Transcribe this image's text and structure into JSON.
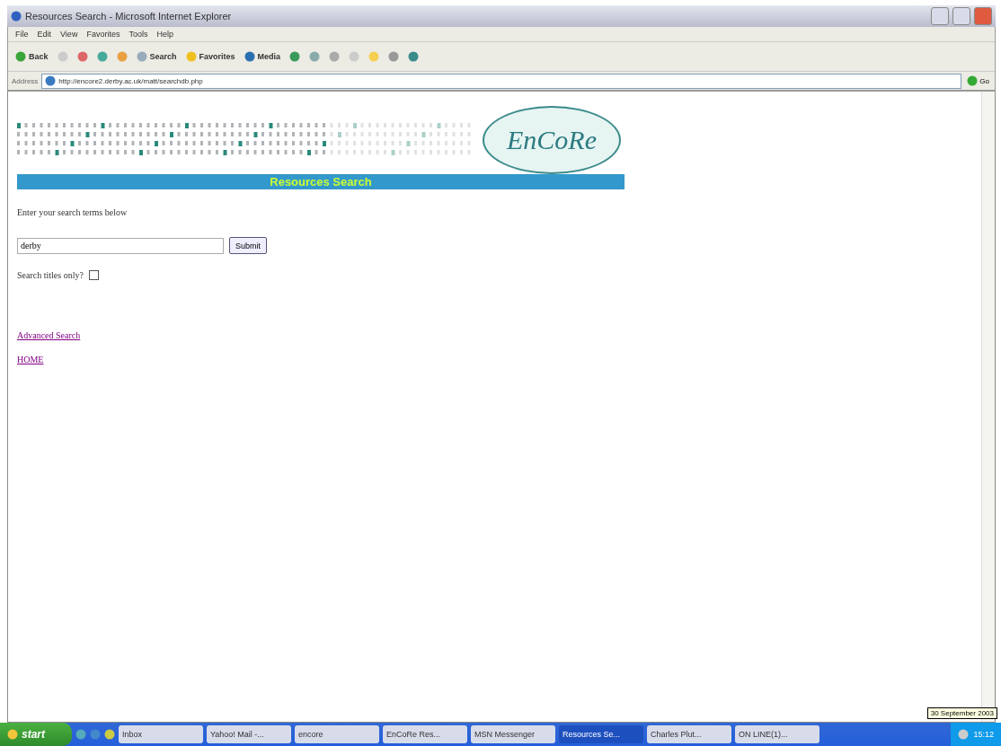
{
  "window": {
    "title": "Resources Search - Microsoft Internet Explorer"
  },
  "menu": [
    "File",
    "Edit",
    "View",
    "Favorites",
    "Tools",
    "Help"
  ],
  "toolbar": {
    "back": "Back",
    "search": "Search",
    "favorites": "Favorites",
    "media": "Media"
  },
  "address_bar": {
    "label": "Address",
    "value": "http://encore2.derby.ac.uk/matt/searchdb.php",
    "go": "Go"
  },
  "page": {
    "logo": "EnCoRe",
    "banner": "Resources Search",
    "intro": "Enter your search terms below",
    "search_field": {
      "value": "derby"
    },
    "submit": "Submit",
    "titles_only": {
      "label": "Search titles only?",
      "checked": false
    },
    "links": [
      "Advanced Search",
      "HOME"
    ]
  },
  "taskbar": {
    "start": "start",
    "items": [
      {
        "label": "Inbox",
        "selected": false
      },
      {
        "label": "Yahoo! Mail -...",
        "selected": false
      },
      {
        "label": "encore",
        "selected": false
      },
      {
        "label": "EnCoRe Res...",
        "selected": false
      },
      {
        "label": "MSN Messenger",
        "selected": false
      },
      {
        "label": "Resources Se...",
        "selected": true
      },
      {
        "label": "Charles Plut...",
        "selected": false
      },
      {
        "label": "ON LINE(1)...",
        "selected": false
      }
    ],
    "tooltip": "30 September 2003",
    "clock": "15:12"
  }
}
